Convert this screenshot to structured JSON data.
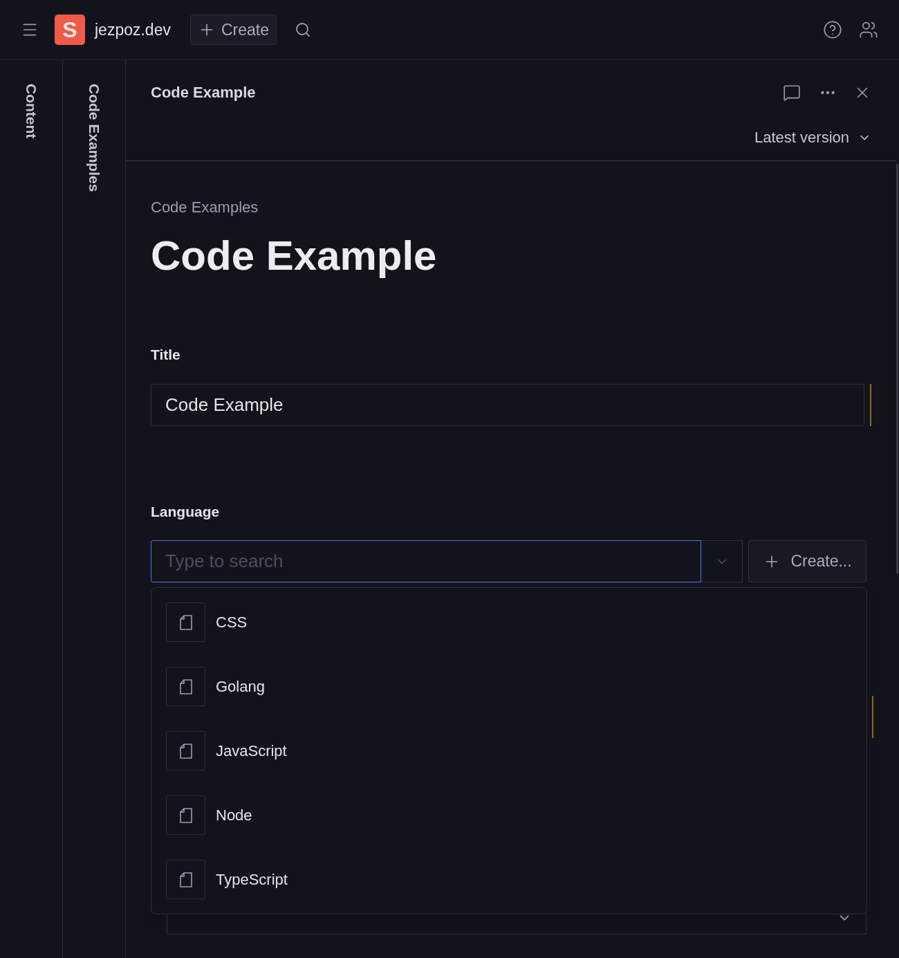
{
  "top_bar": {
    "logo_letter": "S",
    "brand": "jezpoz.dev",
    "create_button": "Create"
  },
  "rail": [
    {
      "label": "Content"
    },
    {
      "label": "Code Examples"
    }
  ],
  "document": {
    "header_title": "Code Example",
    "version": "Latest version",
    "breadcrumb": "Code Examples",
    "heading": "Code Example"
  },
  "title_field": {
    "label": "Title",
    "value": "Code Example"
  },
  "language_field": {
    "label": "Language",
    "placeholder": "Type to search",
    "focused": true,
    "create_button": "Create...",
    "options": [
      {
        "label": "CSS"
      },
      {
        "label": "Golang"
      },
      {
        "label": "JavaScript"
      },
      {
        "label": "Node"
      },
      {
        "label": "TypeScript"
      }
    ]
  }
}
